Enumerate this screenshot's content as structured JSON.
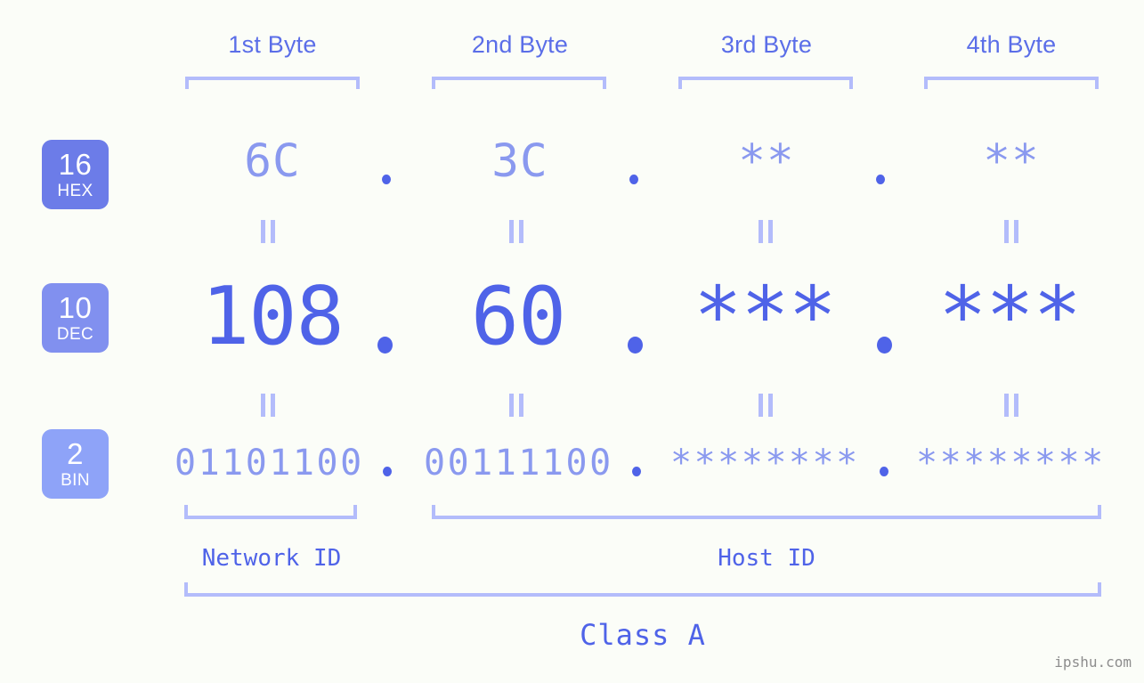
{
  "watermark": "ipshu.com",
  "byte_headers": [
    {
      "label": "1st Byte"
    },
    {
      "label": "2nd Byte"
    },
    {
      "label": "3rd Byte"
    },
    {
      "label": "4th Byte"
    }
  ],
  "bases": [
    {
      "radix": "16",
      "name": "HEX",
      "color": "#6c7ce8"
    },
    {
      "radix": "10",
      "name": "DEC",
      "color": "#8190ef"
    },
    {
      "radix": "2",
      "name": "BIN",
      "color": "#8ea3f8"
    }
  ],
  "rows": {
    "hex": {
      "radix": "16",
      "name": "HEX",
      "values": [
        "6C",
        "3C",
        "**",
        "**"
      ],
      "separator": "."
    },
    "dec": {
      "radix": "10",
      "name": "DEC",
      "values": [
        "108",
        "60",
        "***",
        "***"
      ],
      "separator": "."
    },
    "bin": {
      "radix": "2",
      "name": "BIN",
      "values": [
        "01101100",
        "00111100",
        "********",
        "********"
      ],
      "separator": "."
    }
  },
  "equivalence_symbol": "=",
  "sections": {
    "network_id": "Network ID",
    "host_id": "Host ID",
    "class": "Class A"
  },
  "colors": {
    "background": "#fbfdf8",
    "accent_dark": "#4f63e8",
    "accent_mid": "#8a99ef",
    "accent_light": "#b3bcfb",
    "header_text": "#5b6ee8"
  }
}
